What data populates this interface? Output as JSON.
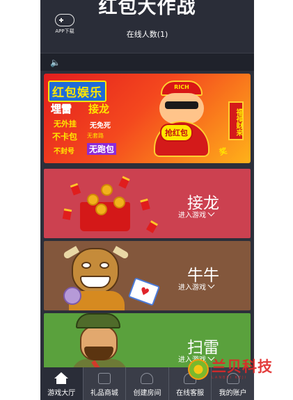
{
  "header": {
    "title": "红包大作战",
    "online": "在线人数(1)",
    "app_download": "APP下载"
  },
  "notice": {
    "icon": "speaker-icon"
  },
  "banner": {
    "title": "红包娱乐",
    "line1a": "埋雷",
    "line1b": "接龙",
    "line2a": "无外挂",
    "line2b": "无免死",
    "line3a": "不卡包",
    "line3b": "无套路",
    "line4a": "不封号",
    "line4b": "无跑包",
    "cap_text": "RICH",
    "grab_text": "抢红包",
    "fortune_text": "福禄财来",
    "prize_text": "奖"
  },
  "games": [
    {
      "name": "接龙",
      "enter": "进入游戏"
    },
    {
      "name": "牛牛",
      "enter": "进入游戏"
    },
    {
      "name": "扫雷",
      "enter": "进入游戏"
    }
  ],
  "tabbar": {
    "items": [
      {
        "label": "游戏大厅",
        "icon": "home-icon",
        "active": true
      },
      {
        "label": "礼品商城",
        "icon": "shop-icon",
        "active": false
      },
      {
        "label": "创建房间",
        "icon": "group-icon",
        "active": false
      },
      {
        "label": "在线客服",
        "icon": "support-icon",
        "active": false
      },
      {
        "label": "我的账户",
        "icon": "user-icon",
        "active": false
      }
    ]
  },
  "watermark": {
    "text": "兰贝科技",
    "sub": "LANBEI KEJI"
  },
  "colors": {
    "background": "#2c2f3a",
    "jielong": "#cc4150",
    "niuniu": "#83573c",
    "saolei": "#5aa13d"
  }
}
